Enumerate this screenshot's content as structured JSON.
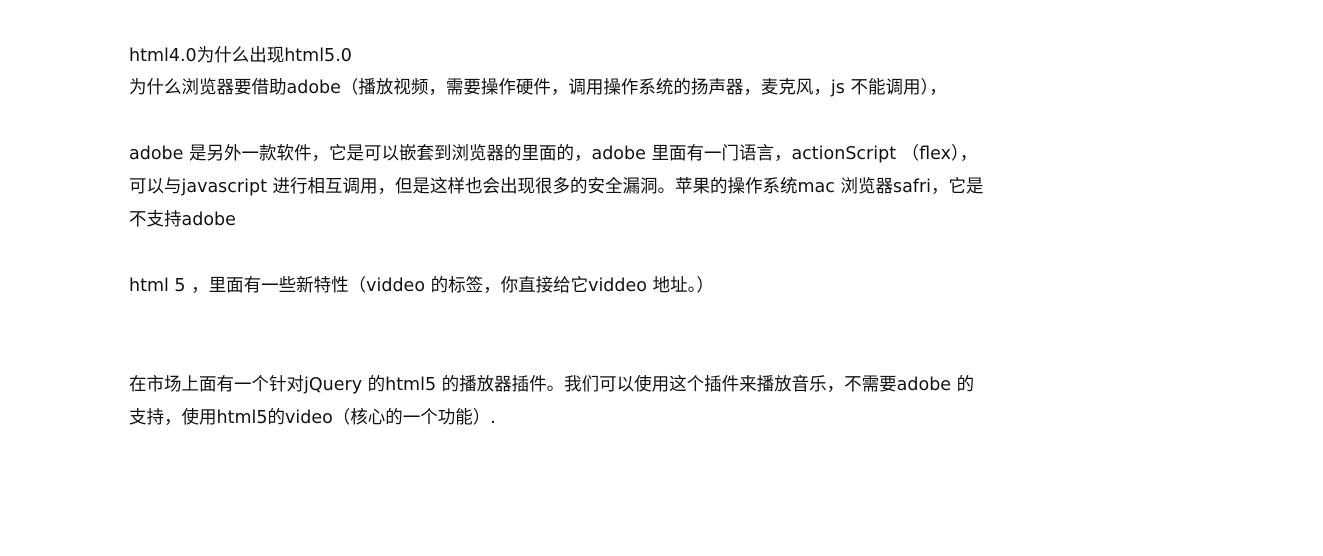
{
  "article": {
    "lines": [
      "html4.0为什么出现html5.0",
      "为什么浏览器要借助adobe（播放视频，需要操作硬件，调用操作系统的扬声器，麦克风，js 不能调用），",
      "adobe 是另外一款软件，它是可以嵌套到浏览器的里面的，adobe 里面有一门语言，actionScript （flex），",
      "可以与javascript 进行相互调用，但是这样也会出现很多的安全漏洞。苹果的操作系统mac 浏览器safri，它是",
      "不支持adobe",
      "html 5 ，里面有一些新特性（viddeo 的标签，你直接给它viddeo 地址。）",
      "在市场上面有一个针对jQuery 的html5 的播放器插件。我们可以使用这个插件来播放音乐，不需要adobe 的",
      "支持，使用html5的video（核心的一个功能）."
    ]
  }
}
